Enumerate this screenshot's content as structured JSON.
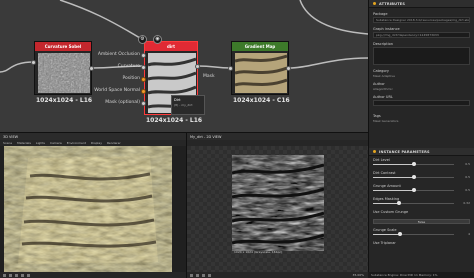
{
  "graph": {
    "nodes": {
      "curvature": {
        "title": "Curvature Sobel",
        "resolution": "1024x1024 - L16"
      },
      "dirt": {
        "title": "dirt",
        "resolution": "1024x1024 - L16"
      },
      "gradient": {
        "title": "Gradient Map",
        "resolution": "1024x1024 - C16"
      }
    },
    "inputs": [
      "Ambient Occlusion",
      "Curvature",
      "Position",
      "World Space Normal",
      "Mask (optional)"
    ],
    "output_label": "Mask",
    "tooltip": {
      "title": "Dirt",
      "subtitle": "(8) - my_dirt"
    }
  },
  "attributes": {
    "header": "ATTRIBUTES",
    "package_label": "Package",
    "package_value": "Substance Designer 2018.3.0/resources/packages/mg_dirt.sbs",
    "graph_instance_label": "Graph instance",
    "graph_instance_value": "pkg:///mg_dirt?dependency=1245873033",
    "description_label": "Description",
    "category_label": "Category",
    "category_value": "Mask Adaptive",
    "author_label": "Author",
    "author_value": "Allegorithmic",
    "author_url_label": "Author URL",
    "tags_label": "Tags",
    "tags_value": "Mask Generators"
  },
  "instance_params": {
    "header": "INSTANCE PARAMETERS",
    "sliders": [
      {
        "label": "Dirt Level",
        "value": 0.5,
        "display": "0.5"
      },
      {
        "label": "Dirt Contrast",
        "value": 0.5,
        "display": "0.5"
      },
      {
        "label": "Grunge Amount",
        "value": 0.5,
        "display": "0.5"
      },
      {
        "label": "Edges Masking",
        "value": 0.32,
        "display": "0.32"
      }
    ],
    "toggle": {
      "label": "Use Custom Grunge",
      "value": "False"
    },
    "scale": {
      "label": "Grunge Scale",
      "value": 0.33,
      "display": "4"
    },
    "triplanar_label": "Use Triplanar"
  },
  "view3d": {
    "title": "3D VIEW",
    "menus": [
      "Scene",
      "Materials",
      "Lights",
      "Camera",
      "Environment",
      "Display",
      "Renderer"
    ]
  },
  "view2d": {
    "title": "My_dirt - 2D VIEW",
    "image_info": "1024 x 1024 (Grayscale, 16bpc)",
    "zoom": "35.00%"
  },
  "footer": "Substance Engine: Direct3D 11  Memory: 1%"
}
